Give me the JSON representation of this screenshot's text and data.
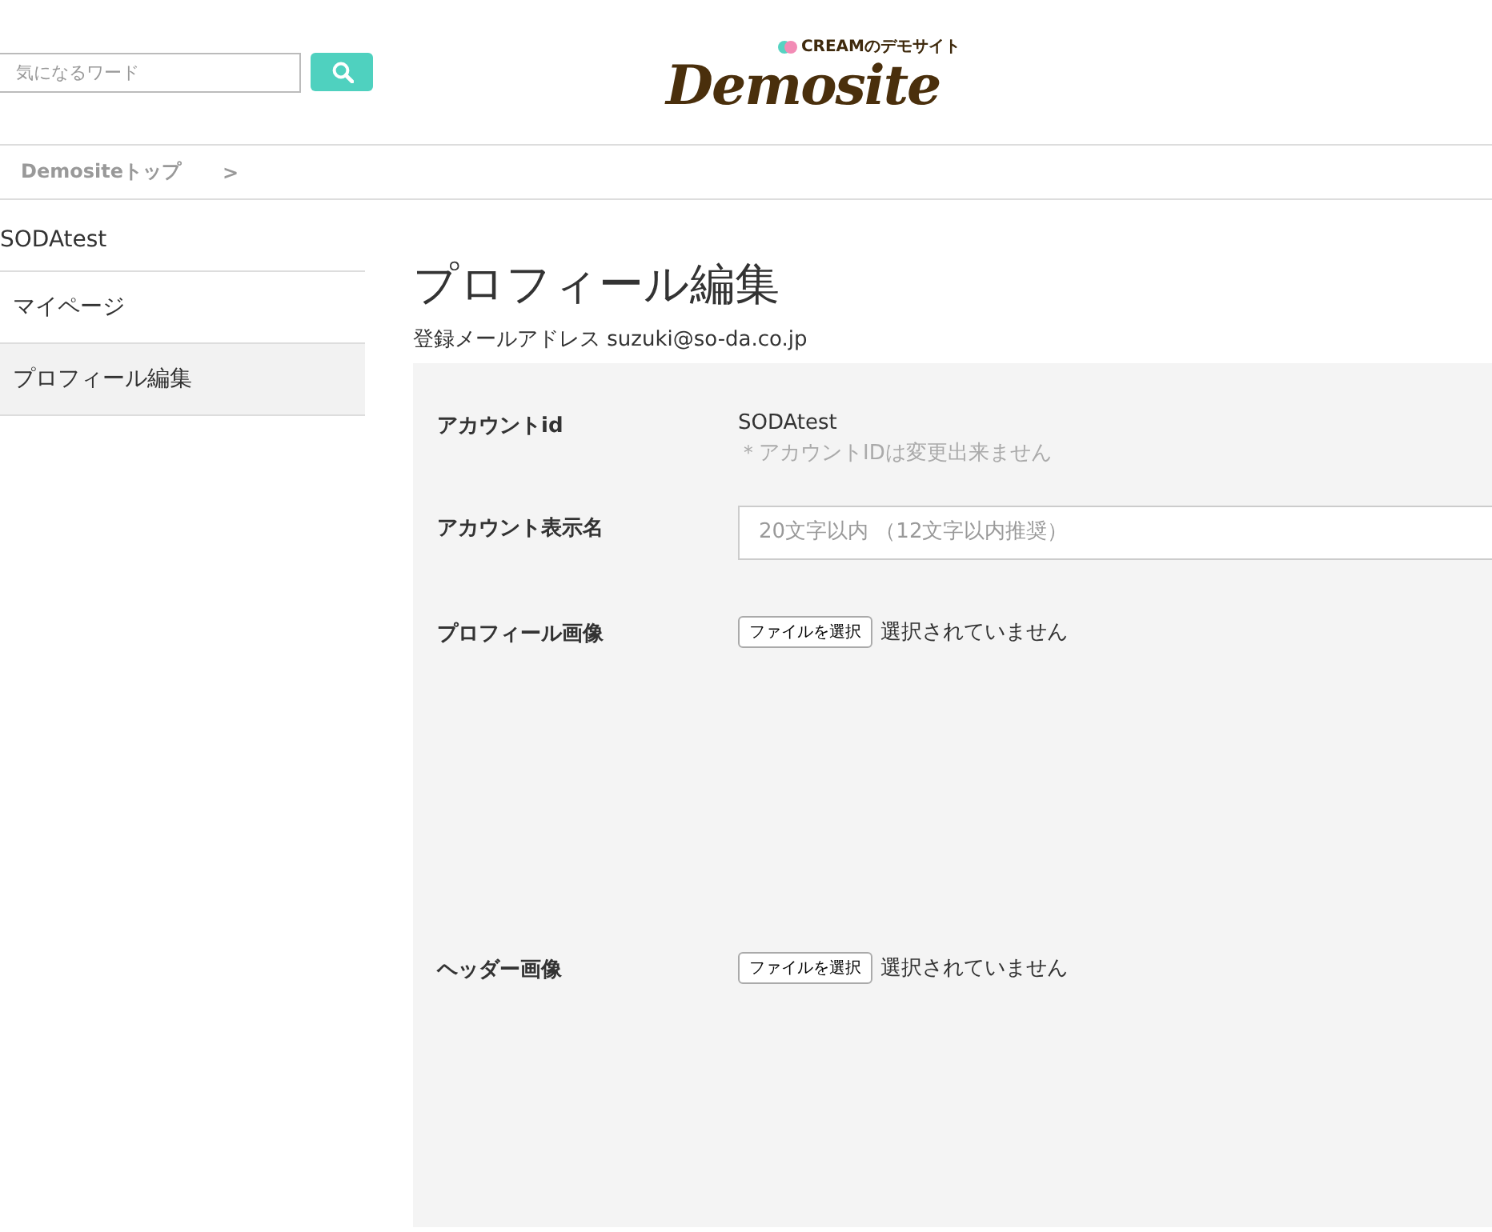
{
  "header": {
    "search": {
      "placeholder": "気になるワード"
    },
    "logo": {
      "tagline": "CREAMのデモサイト",
      "name": "Demosite"
    }
  },
  "breadcrumb": [
    {
      "label": "Demositeトップ"
    },
    {
      "label": ">"
    }
  ],
  "sidebar": {
    "title": "SODAtest",
    "items": [
      {
        "label": "マイページ",
        "selected": false
      },
      {
        "label": "プロフィール編集",
        "selected": true
      }
    ]
  },
  "main": {
    "title": "プロフィール編集",
    "email": "登録メールアドレス suzuki@so-da.co.jp",
    "fields": [
      {
        "kind": "text",
        "label": "アカウントid",
        "value": "SODAtest",
        "note": "＊アカウントIDは変更出来ません"
      },
      {
        "kind": "input",
        "label": "アカウント表示名",
        "placeholder": "20文字以内 （12文字以内推奨）"
      },
      {
        "kind": "file",
        "label": "プロフィール画像",
        "button": "ファイルを選択",
        "status": "選択されていません"
      },
      {
        "kind": "file",
        "label": "ヘッダー画像",
        "button": "ファイルを選択",
        "status": "選択されていません"
      }
    ]
  }
}
